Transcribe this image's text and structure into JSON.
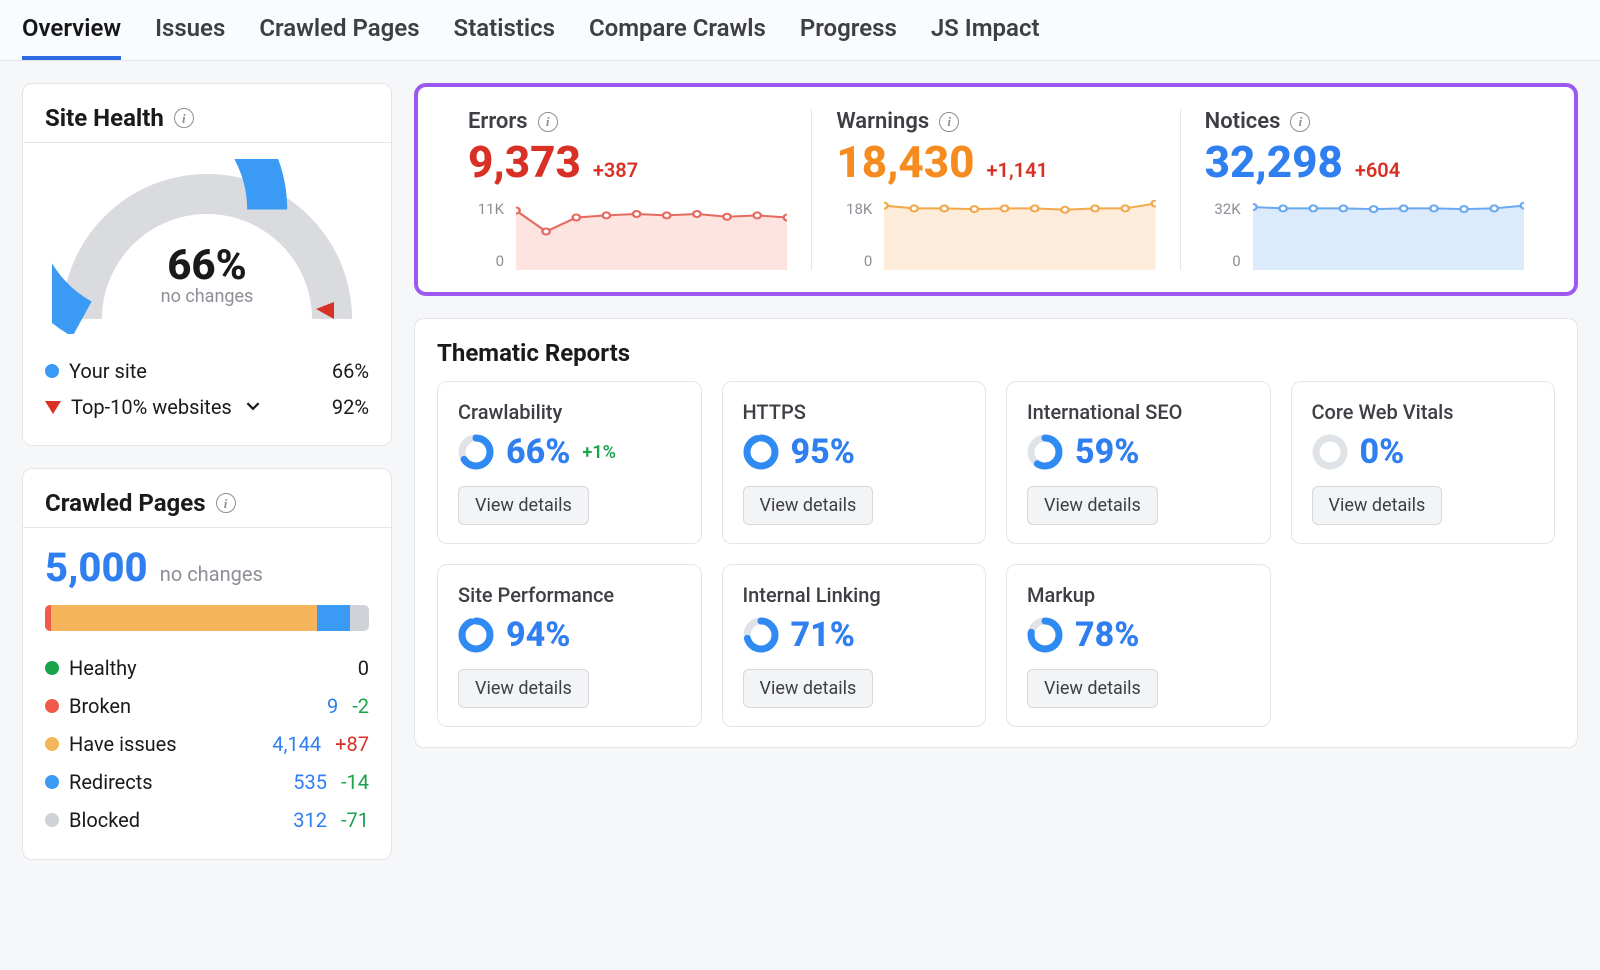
{
  "tabs": [
    "Overview",
    "Issues",
    "Crawled Pages",
    "Statistics",
    "Compare Crawls",
    "Progress",
    "JS Impact"
  ],
  "active_tab": 0,
  "site_health": {
    "title": "Site Health",
    "value": "66%",
    "subtitle": "no changes",
    "gauge_pct": 66,
    "legend": [
      {
        "color": "#3b9bf4",
        "label": "Your site",
        "pct": "66%"
      },
      {
        "triangle": true,
        "label": "Top-10% websites",
        "pct": "92%",
        "chevron": true
      }
    ]
  },
  "crawled_pages": {
    "title": "Crawled Pages",
    "total": "5,000",
    "subtitle": "no changes",
    "bar": [
      {
        "color": "#ef5a4a",
        "pct": 2
      },
      {
        "color": "#f6b55a",
        "pct": 82
      },
      {
        "color": "#3b9bf4",
        "pct": 10
      },
      {
        "color": "#cfd2d6",
        "pct": 6
      }
    ],
    "rows": [
      {
        "dot": "#1ba34b",
        "label": "Healthy",
        "v": "0",
        "d": ""
      },
      {
        "dot": "#ef5a4a",
        "label": "Broken",
        "v": "9",
        "d": "-2",
        "dclass": "v-green"
      },
      {
        "dot": "#f6b55a",
        "label": "Have issues",
        "v": "4,144",
        "d": "+87",
        "dclass": "v-red"
      },
      {
        "dot": "#3b9bf4",
        "label": "Redirects",
        "v": "535",
        "d": "-14",
        "dclass": "v-green"
      },
      {
        "dot": "#cfd2d6",
        "label": "Blocked",
        "v": "312",
        "d": "-71",
        "dclass": "v-green"
      }
    ]
  },
  "metrics": [
    {
      "title": "Errors",
      "value": "9,373",
      "delta": "+387",
      "color": "#d93025",
      "top": "11K",
      "bottom": "0",
      "fill": "#fde4e1",
      "stroke": "#e56a5f",
      "points": [
        0.15,
        0.45,
        0.25,
        0.22,
        0.2,
        0.22,
        0.2,
        0.24,
        0.22,
        0.25
      ]
    },
    {
      "title": "Warnings",
      "value": "18,430",
      "delta": "+1,141",
      "color": "#f68b1f",
      "top": "18K",
      "bottom": "0",
      "fill": "#fdecd9",
      "stroke": "#f2a94c",
      "points": [
        0.08,
        0.12,
        0.12,
        0.13,
        0.12,
        0.12,
        0.14,
        0.12,
        0.12,
        0.05
      ]
    },
    {
      "title": "Notices",
      "value": "32,298",
      "delta": "+604",
      "color": "#2f7ff0",
      "top": "32K",
      "bottom": "0",
      "fill": "#dcebfb",
      "stroke": "#6aa9ee",
      "points": [
        0.1,
        0.12,
        0.12,
        0.12,
        0.13,
        0.12,
        0.12,
        0.13,
        0.12,
        0.08
      ]
    }
  ],
  "thematic": {
    "title": "Thematic Reports",
    "button_label": "View details",
    "reports": [
      {
        "title": "Crawlability",
        "pct": 66,
        "value": "66%",
        "delta": "+1%",
        "delta_color": "#1ba34b"
      },
      {
        "title": "HTTPS",
        "pct": 95,
        "value": "95%"
      },
      {
        "title": "International SEO",
        "pct": 59,
        "value": "59%"
      },
      {
        "title": "Core Web Vitals",
        "pct": 0,
        "value": "0%"
      },
      {
        "title": "Site Performance",
        "pct": 94,
        "value": "94%"
      },
      {
        "title": "Internal Linking",
        "pct": 71,
        "value": "71%"
      },
      {
        "title": "Markup",
        "pct": 78,
        "value": "78%"
      }
    ]
  },
  "colors": {
    "ring_blue": "#2f8af2",
    "ring_track": "#dfe2e6"
  },
  "chart_data": {
    "site_health_gauge": {
      "type": "gauge",
      "value": 66,
      "max": 100,
      "marker": 92
    },
    "crawled_bar": {
      "type": "stacked-bar",
      "total": 5000,
      "segments": {
        "Broken": 9,
        "Have issues": 4144,
        "Redirects": 535,
        "Blocked": 312,
        "Healthy": 0
      }
    },
    "metrics_sparklines": [
      {
        "name": "Errors",
        "type": "area",
        "ylim": [
          0,
          11000
        ],
        "y": [
          9350,
          6050,
          8250,
          8580,
          8800,
          8580,
          8800,
          8360,
          8580,
          8250
        ]
      },
      {
        "name": "Warnings",
        "type": "area",
        "ylim": [
          0,
          18000
        ],
        "y": [
          16560,
          15840,
          15840,
          15660,
          15840,
          15840,
          15480,
          15840,
          15840,
          17100
        ]
      },
      {
        "name": "Notices",
        "type": "area",
        "ylim": [
          0,
          32000
        ],
        "y": [
          28800,
          28160,
          28160,
          28160,
          27840,
          28160,
          28160,
          27840,
          28160,
          29440
        ]
      }
    ],
    "thematic_rings": [
      {
        "name": "Crawlability",
        "pct": 66
      },
      {
        "name": "HTTPS",
        "pct": 95
      },
      {
        "name": "International SEO",
        "pct": 59
      },
      {
        "name": "Core Web Vitals",
        "pct": 0
      },
      {
        "name": "Site Performance",
        "pct": 94
      },
      {
        "name": "Internal Linking",
        "pct": 71
      },
      {
        "name": "Markup",
        "pct": 78
      }
    ]
  }
}
